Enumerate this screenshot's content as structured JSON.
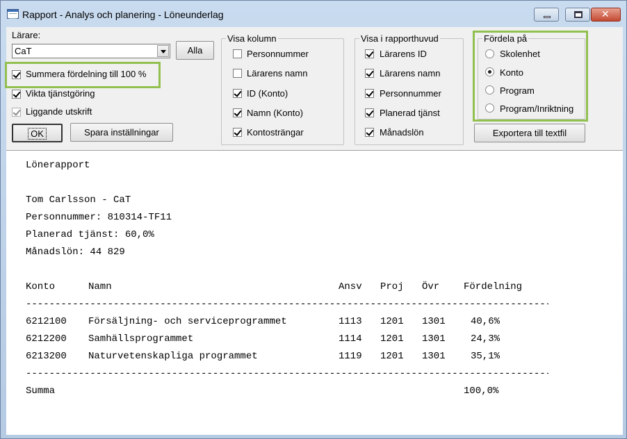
{
  "window": {
    "title": "Rapport - Analys och planering - Löneunderlag",
    "close_glyph": "✕"
  },
  "teacher": {
    "label": "Lärare:",
    "selected": "CaT",
    "all_button": "Alla"
  },
  "options": [
    {
      "label": "Summera fördelning till 100 %",
      "checked": true,
      "disabled": false
    },
    {
      "label": "Vikta tjänstgöring",
      "checked": true,
      "disabled": false
    },
    {
      "label": "Liggande utskrift",
      "checked": true,
      "disabled": true
    }
  ],
  "buttons": {
    "ok": "OK",
    "save_settings": "Spara inställningar",
    "export": "Exportera till textfil"
  },
  "show_columns": {
    "title": "Visa kolumn",
    "items": [
      {
        "label": "Personnummer",
        "checked": false
      },
      {
        "label": "Lärarens namn",
        "checked": false
      },
      {
        "label": "ID (Konto)",
        "checked": true
      },
      {
        "label": "Namn (Konto)",
        "checked": true
      },
      {
        "label": "Kontosträngar",
        "checked": true
      }
    ]
  },
  "show_header": {
    "title": "Visa i rapporthuvud",
    "items": [
      {
        "label": "Lärarens ID",
        "checked": true
      },
      {
        "label": "Lärarens namn",
        "checked": true
      },
      {
        "label": "Personnummer",
        "checked": true
      },
      {
        "label": "Planerad tjänst",
        "checked": true
      },
      {
        "label": "Månadslön",
        "checked": true
      }
    ]
  },
  "distribute": {
    "title": "Fördela på",
    "selected": "Konto",
    "options": [
      "Skolenhet",
      "Konto",
      "Program",
      "Program/Inriktning"
    ]
  },
  "report": {
    "heading": "Lönerapport",
    "person": "Tom Carlsson - CaT",
    "ssn": "Personnummer: 810314-TF11",
    "planned": "Planerad tjänst: 60,0%",
    "salary": "Månadslön: 44 829",
    "columns": {
      "konto": "Konto",
      "namn": "Namn",
      "ansv": "Ansv",
      "proj": "Proj",
      "ovr": "Övr",
      "fordelning": "Fördelning"
    },
    "separator": "------------------------------------------------------------------------------------------------------",
    "rows": [
      {
        "konto": "6212100",
        "namn": "Försäljning- och serviceprogrammet",
        "ansv": "1113",
        "proj": "1201",
        "ovr": "1301",
        "fordelning": "40,6%"
      },
      {
        "konto": "6212200",
        "namn": "Samhällsprogrammet",
        "ansv": "1114",
        "proj": "1201",
        "ovr": "1301",
        "fordelning": "24,3%"
      },
      {
        "konto": "6213200",
        "namn": "Naturvetenskapliga programmet",
        "ansv": "1119",
        "proj": "1201",
        "ovr": "1301",
        "fordelning": "35,1%"
      }
    ],
    "sum_label": "Summa",
    "sum_value": "100,0%"
  },
  "colors": {
    "highlight": "#92c050"
  }
}
